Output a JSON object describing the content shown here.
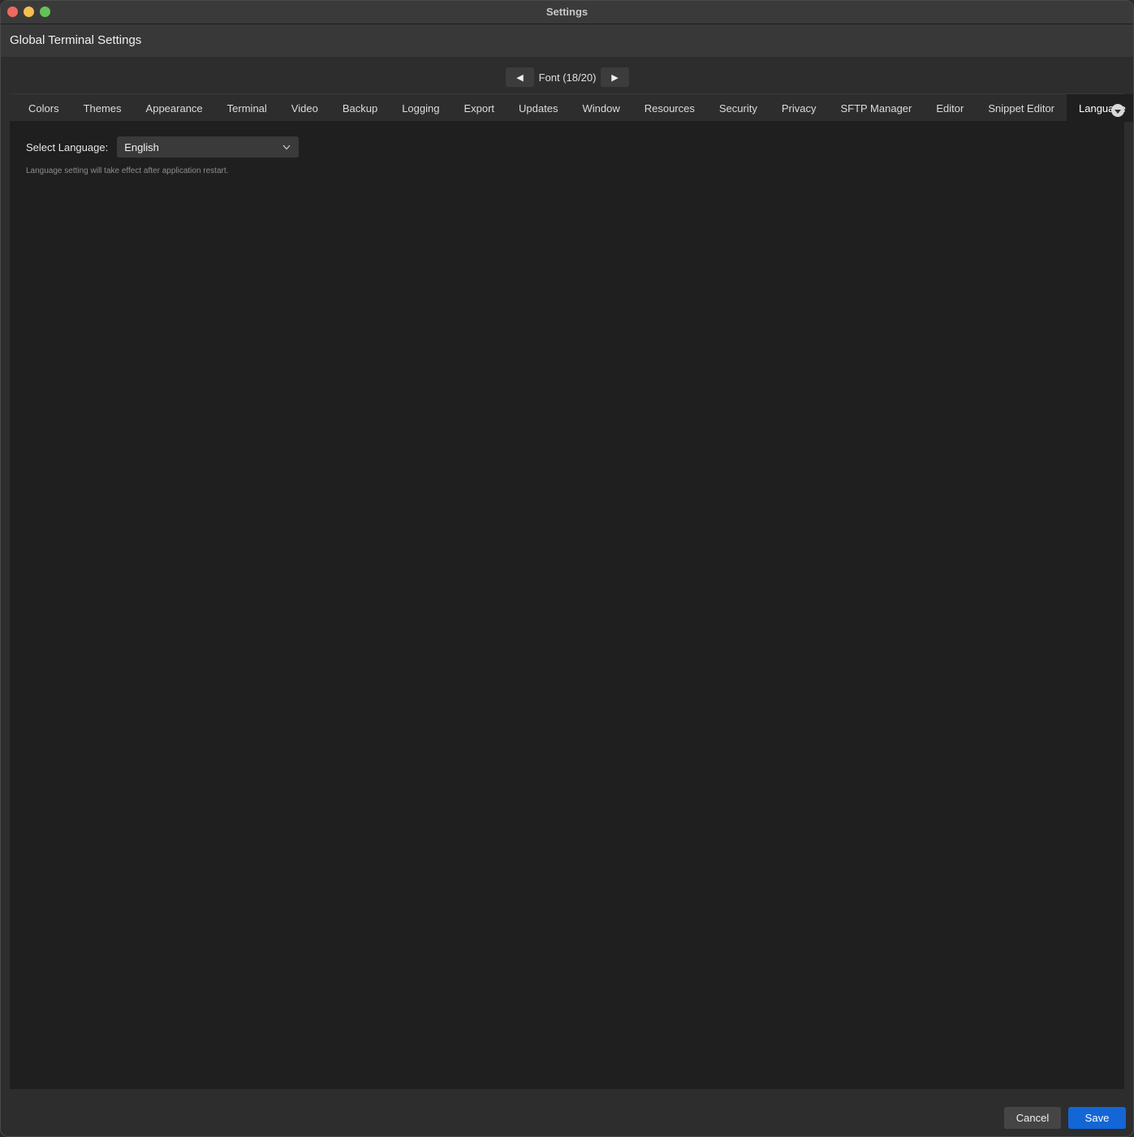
{
  "window": {
    "title": "Settings"
  },
  "header": {
    "title": "Global Terminal Settings"
  },
  "pager": {
    "prev_icon": "◀",
    "next_icon": "▶",
    "label": "Font (18/20)"
  },
  "tabs": [
    {
      "label": "Colors"
    },
    {
      "label": "Themes"
    },
    {
      "label": "Appearance"
    },
    {
      "label": "Terminal"
    },
    {
      "label": "Video"
    },
    {
      "label": "Backup"
    },
    {
      "label": "Logging"
    },
    {
      "label": "Export"
    },
    {
      "label": "Updates"
    },
    {
      "label": "Window"
    },
    {
      "label": "Resources"
    },
    {
      "label": "Security"
    },
    {
      "label": "Privacy"
    },
    {
      "label": "SFTP Manager"
    },
    {
      "label": "Editor"
    },
    {
      "label": "Snippet Editor"
    },
    {
      "label": "Language"
    }
  ],
  "active_tab": "Language",
  "language": {
    "label": "Select Language:",
    "selected": "English",
    "hint": "Language setting will take effect after application restart."
  },
  "footer": {
    "cancel_label": "Cancel",
    "save_label": "Save"
  },
  "colors": {
    "accent": "#1366d6",
    "close": "#ed6a5e",
    "minimize": "#f5bf4f",
    "maximize": "#61c454"
  }
}
